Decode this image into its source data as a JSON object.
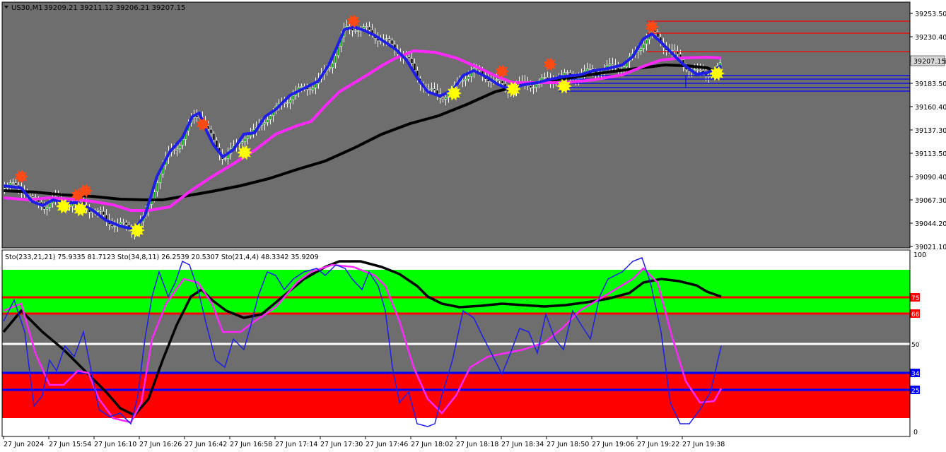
{
  "window": {
    "symbol_label": "US30,M1",
    "ohlc_label": "39209.21 39211.12 39206.21 39207.15"
  },
  "colors": {
    "price_bg": "#6e6e6e",
    "ma_fast": "#1e1ee6",
    "ma_mid": "#ff28ff",
    "ma_slow": "#000000",
    "resistance": "#ff0000",
    "support": "#0000ff",
    "sell_marker": "#ff4a14",
    "buy_marker": "#ffff00",
    "zone_upper": "#00ff00",
    "zone_lower": "#ff0000",
    "price_box": "#d8d8d8"
  },
  "price_axis": {
    "ticks": [
      "39253.50",
      "39230.40",
      "39207.15",
      "39183.50",
      "39160.40",
      "39137.30",
      "39113.50",
      "39090.40",
      "39067.30",
      "39044.20",
      "39021.10"
    ],
    "current_price": "39207.15"
  },
  "indicator": {
    "header": "Sto(233,21,21) 75.9335 81.7123  Sto(34,8,11) 26.2539 20.5307  Sto(21,4,4) 48.3342 35.9209",
    "axis_top": "100",
    "axis_bottom": "0",
    "levels": [
      {
        "label": "75",
        "color": "#ff0000"
      },
      {
        "label": "66",
        "color": "#ff0000"
      },
      {
        "label": "50",
        "color": "#ffffff"
      },
      {
        "label": "34",
        "color": "#0000ff"
      },
      {
        "label": "25",
        "color": "#0000ff"
      }
    ]
  },
  "time_axis": {
    "labels": [
      "27 Jun 2024",
      "27 Jun 15:54",
      "27 Jun 16:10",
      "27 Jun 16:26",
      "27 Jun 16:42",
      "27 Jun 16:58",
      "27 Jun 17:14",
      "27 Jun 17:30",
      "27 Jun 17:46",
      "27 Jun 18:02",
      "27 Jun 18:18",
      "27 Jun 18:34",
      "27 Jun 18:50",
      "27 Jun 19:06",
      "27 Jun 19:22",
      "27 Jun 19:38"
    ]
  }
}
